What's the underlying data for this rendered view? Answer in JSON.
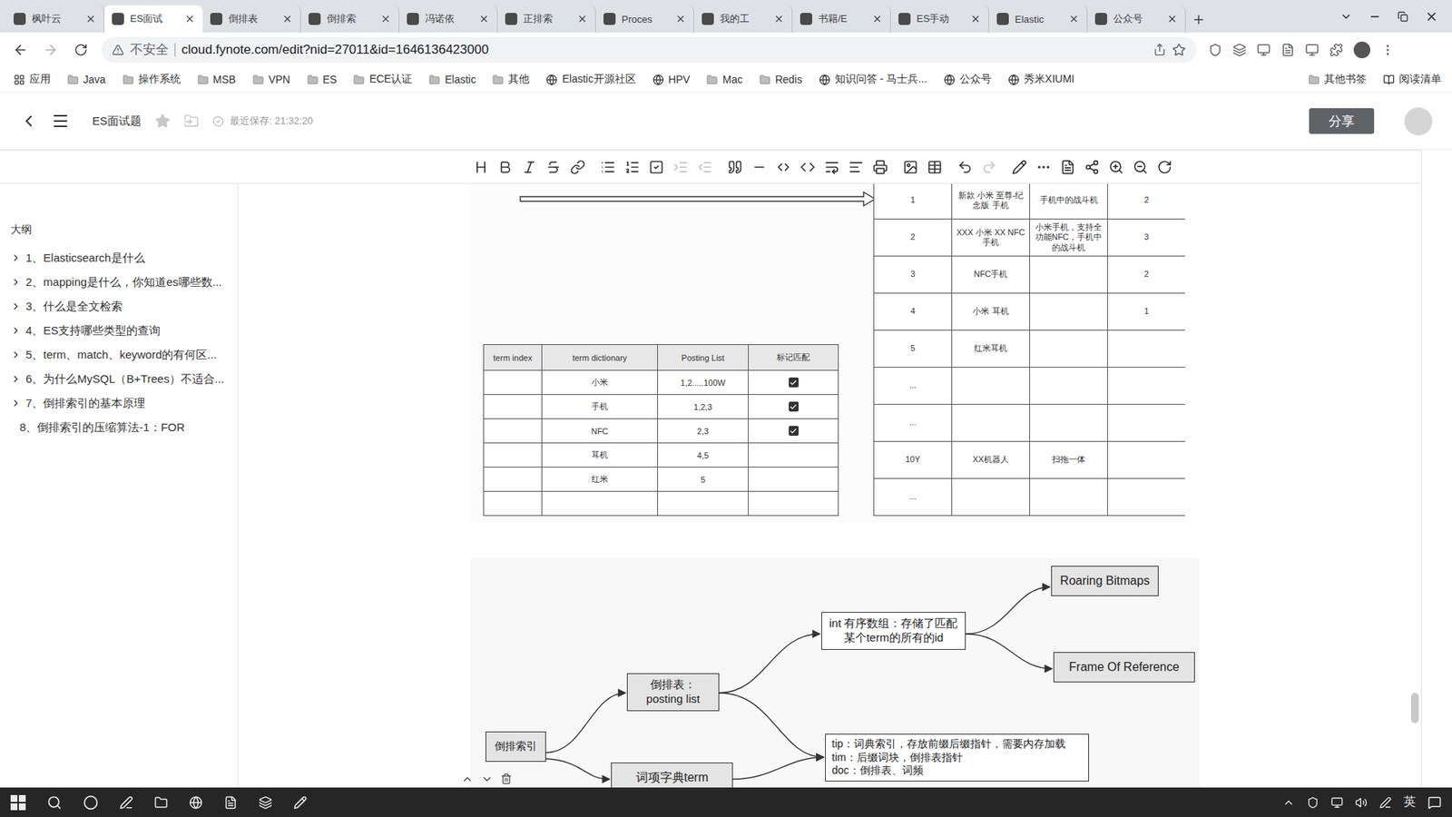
{
  "browser": {
    "tabs": [
      {
        "label": "枫叶云",
        "selected": false
      },
      {
        "label": "ES面试",
        "selected": true
      },
      {
        "label": "倒排表",
        "selected": false
      },
      {
        "label": "倒排索",
        "selected": false
      },
      {
        "label": "冯诺依",
        "selected": false
      },
      {
        "label": "正排索",
        "selected": false
      },
      {
        "label": "Proces",
        "selected": false
      },
      {
        "label": "我的工",
        "selected": false
      },
      {
        "label": "书籍/E",
        "selected": false
      },
      {
        "label": "ES手动",
        "selected": false
      },
      {
        "label": "Elastic",
        "selected": false
      },
      {
        "label": "公众号",
        "selected": false
      }
    ],
    "address": {
      "security": "不安全",
      "url": "cloud.fynote.com/edit?nid=27011&id=1646136423000"
    },
    "bookmarks": [
      {
        "label": "应用",
        "kind": "apps"
      },
      {
        "label": "Java",
        "kind": "folder"
      },
      {
        "label": "操作系统",
        "kind": "folder"
      },
      {
        "label": "MSB",
        "kind": "folder"
      },
      {
        "label": "VPN",
        "kind": "folder"
      },
      {
        "label": "ES",
        "kind": "folder"
      },
      {
        "label": "ECE认证",
        "kind": "folder"
      },
      {
        "label": "Elastic",
        "kind": "folder"
      },
      {
        "label": "其他",
        "kind": "folder"
      },
      {
        "label": "Elastic开源社区",
        "kind": "site"
      },
      {
        "label": "HPV",
        "kind": "site"
      },
      {
        "label": "Mac",
        "kind": "folder"
      },
      {
        "label": "Redis",
        "kind": "folder"
      },
      {
        "label": "知识问答 - 马士兵...",
        "kind": "site"
      },
      {
        "label": "公众号",
        "kind": "site"
      },
      {
        "label": "秀米XIUMI",
        "kind": "site"
      }
    ],
    "other_bookmarks": [
      {
        "label": "其他书签",
        "kind": "folder"
      },
      {
        "label": "阅读清单",
        "kind": "reading"
      }
    ]
  },
  "app": {
    "title": "ES面试题",
    "starred": false,
    "saved": "最近保存: 21:32:20",
    "share": "分享"
  },
  "toolbar": [
    [
      {
        "kind": "heading",
        "disabled": false
      },
      {
        "kind": "bold",
        "disabled": false
      },
      {
        "kind": "italic",
        "disabled": false
      },
      {
        "kind": "strikethrough",
        "disabled": false
      },
      {
        "kind": "link",
        "disabled": false
      }
    ],
    [
      {
        "kind": "bullet-list",
        "disabled": false
      },
      {
        "kind": "ordered-list",
        "disabled": false
      },
      {
        "kind": "task-list",
        "disabled": false
      },
      {
        "kind": "indent",
        "disabled": true
      },
      {
        "kind": "outdent",
        "disabled": true
      }
    ],
    [
      {
        "kind": "quote",
        "disabled": false
      },
      {
        "kind": "divider",
        "disabled": false
      },
      {
        "kind": "inline-code",
        "disabled": false
      },
      {
        "kind": "code-block",
        "disabled": false
      },
      {
        "kind": "wrap",
        "disabled": false
      },
      {
        "kind": "align",
        "disabled": false
      },
      {
        "kind": "print",
        "disabled": false
      }
    ],
    [
      {
        "kind": "image",
        "disabled": false
      },
      {
        "kind": "table",
        "disabled": false
      }
    ],
    [
      {
        "kind": "undo",
        "disabled": false
      },
      {
        "kind": "redo",
        "disabled": true
      }
    ],
    [
      {
        "kind": "pencil",
        "disabled": false
      },
      {
        "kind": "more",
        "disabled": false
      },
      {
        "kind": "file",
        "disabled": false
      },
      {
        "kind": "mindmap",
        "disabled": false
      },
      {
        "kind": "zoom-in",
        "disabled": false
      },
      {
        "kind": "zoom-out",
        "disabled": false
      },
      {
        "kind": "refresh",
        "disabled": false
      }
    ]
  ],
  "outline": {
    "title": "大纲",
    "items": [
      {
        "label": "1、Elasticsearch是什么",
        "has_children": true,
        "expanded": false
      },
      {
        "label": "2、mapping是什么，你知道es哪些数...",
        "has_children": true,
        "expanded": false
      },
      {
        "label": "3、什么是全文检索",
        "has_children": true,
        "expanded": false
      },
      {
        "label": "4、ES支持哪些类型的查询",
        "has_children": true,
        "expanded": false
      },
      {
        "label": "5、term、match、keyword的有何区...",
        "has_children": true,
        "expanded": false
      },
      {
        "label": "6、为什么MySQL（B+Trees）不适合...",
        "has_children": true,
        "expanded": false
      },
      {
        "label": "7、倒排索引的基本原理",
        "has_children": true,
        "expanded": false
      },
      {
        "label": "8、倒排索引的压缩算法-1：FOR",
        "has_children": false,
        "expanded": false
      }
    ]
  },
  "forward_index": {
    "rows": [
      [
        "1",
        "新款 小米 至尊-纪念版 手机",
        "手机中的战斗机",
        "2"
      ],
      [
        "2",
        "XXX 小米 XX NFC 手机",
        "小米手机，支持全功能NFC，手机中的战斗机",
        "3"
      ],
      [
        "3",
        "NFC手机",
        "",
        "2"
      ],
      [
        "4",
        "小米 耳机",
        "",
        "1"
      ],
      [
        "5",
        "红米耳机",
        "",
        ""
      ],
      [
        "...",
        "",
        "",
        ""
      ],
      [
        "...",
        "",
        "",
        ""
      ],
      [
        "10Y",
        "XX机器人",
        "扫拖一体",
        ""
      ],
      [
        "...",
        "",
        "",
        ""
      ]
    ]
  },
  "inverted_index": {
    "columns": [
      "term index",
      "term dictionary",
      "Posting List",
      "标记匹配"
    ],
    "rows": [
      {
        "term": "小米",
        "postings": "1,2.....100W",
        "matched": true
      },
      {
        "term": "手机",
        "postings": "1,2,3",
        "matched": true
      },
      {
        "term": "NFC",
        "postings": "2,3",
        "matched": true
      },
      {
        "term": "耳机",
        "postings": "4,5",
        "matched": false
      },
      {
        "term": "红米",
        "postings": "5",
        "matched": false
      },
      {
        "term": "",
        "postings": "",
        "matched": false
      }
    ]
  },
  "mind_map": {
    "root": "倒排索引",
    "posting_list": [
      "倒排表：",
      "posting list"
    ],
    "term_dict": "词项字典term",
    "int_array": "int 有序数组：存储了匹配某个term的所有的id",
    "roaring": "Roaring Bitmaps",
    "frame_of_reference": "Frame Of Reference",
    "files": [
      "tip：词典索引，存放前缀后缀指针，需要内存加载",
      "tim：后缀词块，倒排表指针",
      "doc：倒排表、词频"
    ]
  },
  "taskbar": {
    "ime": "英"
  }
}
